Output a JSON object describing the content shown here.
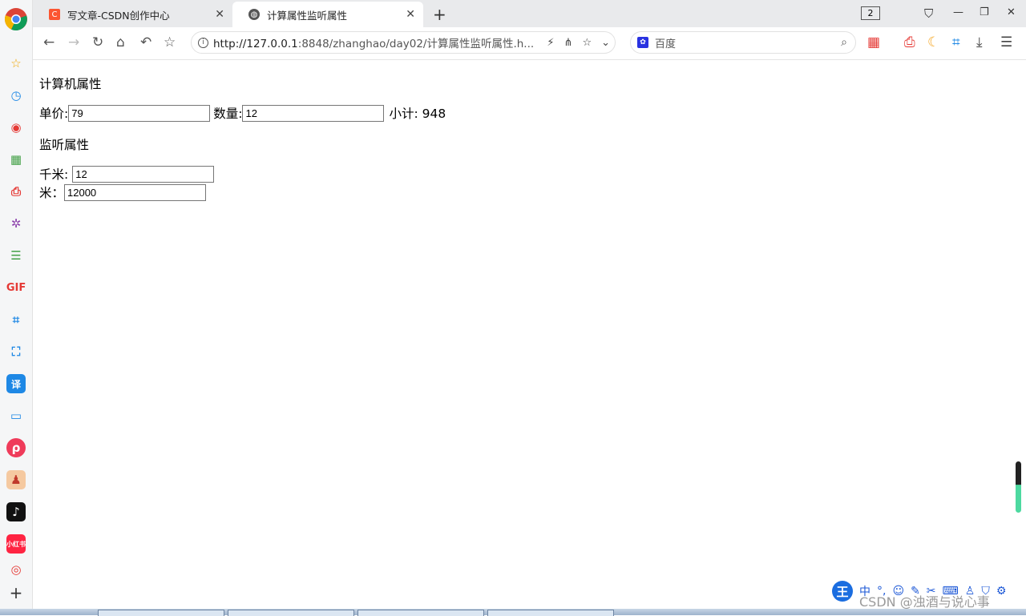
{
  "browser": {
    "tabs": [
      {
        "title": "写文章-CSDN创作中心",
        "favicon": "csdn-logo-icon",
        "active": false
      },
      {
        "title": "计算属性监听属性",
        "favicon": "globe-icon",
        "active": true
      }
    ],
    "tab_count": "2",
    "address": {
      "host": "http://127.0.0.1",
      "rest": ":8848/zhanghao/day02/计算属性监听属性.h..."
    },
    "search": {
      "engine_label": "百度"
    }
  },
  "page": {
    "computed_title": "计算机属性",
    "price_label": "单价:",
    "price_value": "79",
    "quantity_label": "数量:",
    "quantity_value": "12",
    "subtotal_label": "小计: 948",
    "watch_title": "监听属性",
    "km_label": "千米:",
    "km_value": "12",
    "m_label": "米：",
    "m_value": "12000"
  },
  "ime": {
    "mode": "中"
  },
  "watermark": "CSDN @浊酒与说心事",
  "colors": {
    "csdn_red": "#fc5531",
    "accent_orange": "#f5a623",
    "toolbar_red": "#e53935"
  }
}
